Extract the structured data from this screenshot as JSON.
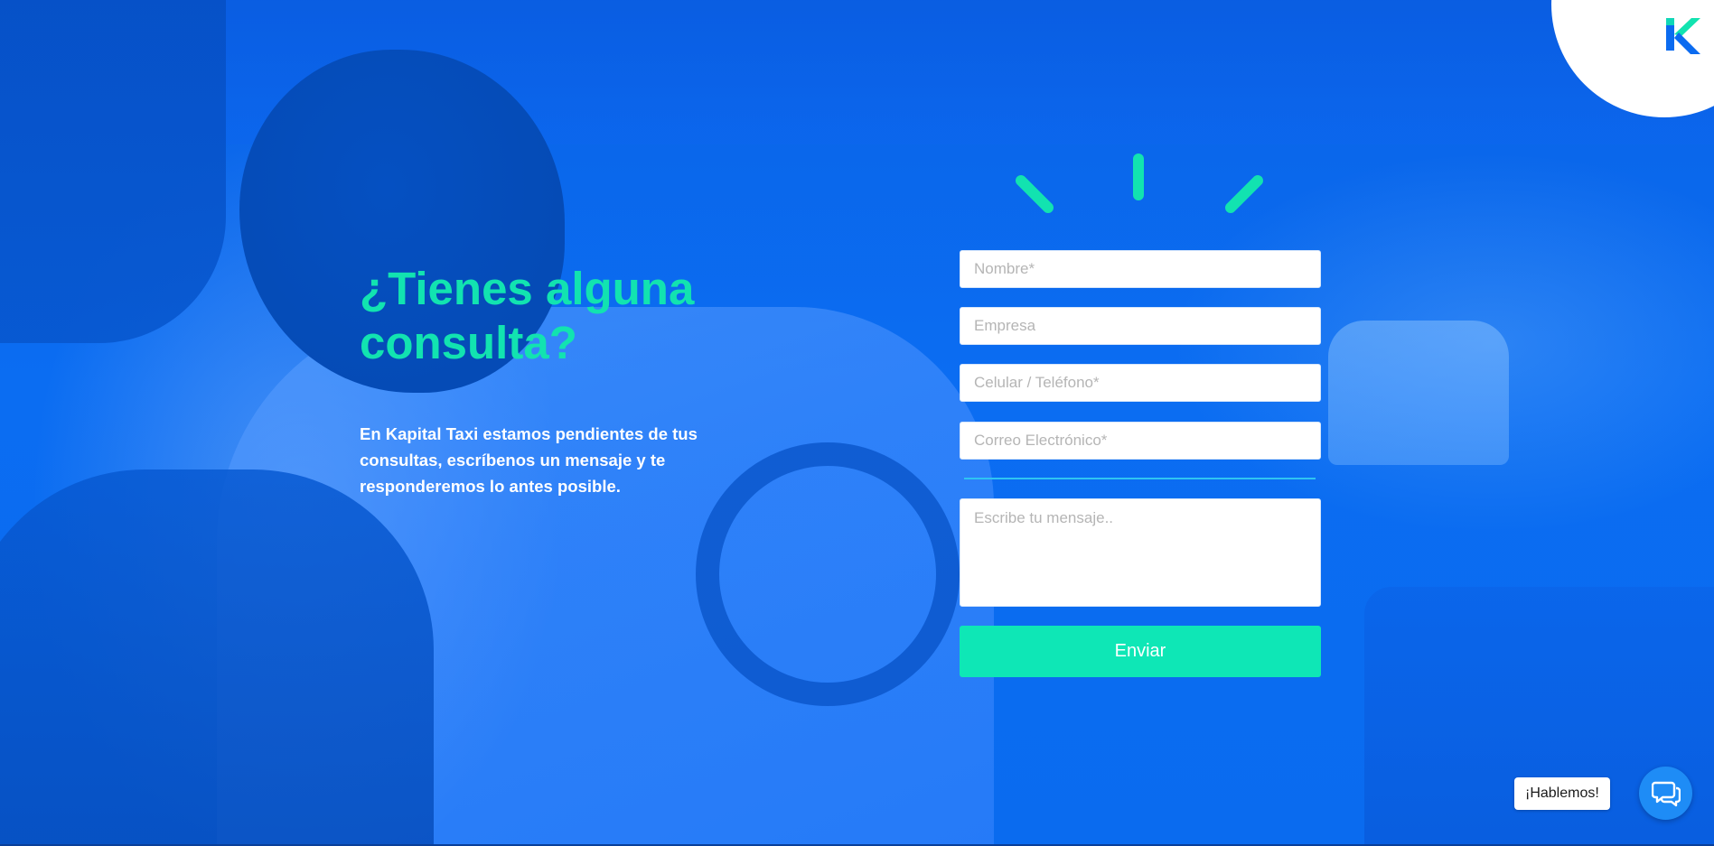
{
  "brand": {
    "logo_icon": "kapital-k-logo-icon",
    "accent_color": "#0ee7b6",
    "heading_color": "#12e3b0",
    "background_color": "#0a6bef"
  },
  "hero": {
    "heading": "¿Tienes alguna consulta?",
    "description": "En Kapital Taxi estamos pendientes de tus consultas, escríbenos un mensaje y te responderemos lo antes posible."
  },
  "form": {
    "name_placeholder": "Nombre*",
    "company_placeholder": "Empresa",
    "phone_placeholder": "Celular / Teléfono*",
    "email_placeholder": "Correo Electrónico*",
    "message_placeholder": "Escribe tu mensaje..",
    "submit_label": "Enviar"
  },
  "chat": {
    "label": "¡Hablemos!",
    "icon": "chat-bubbles-icon"
  }
}
